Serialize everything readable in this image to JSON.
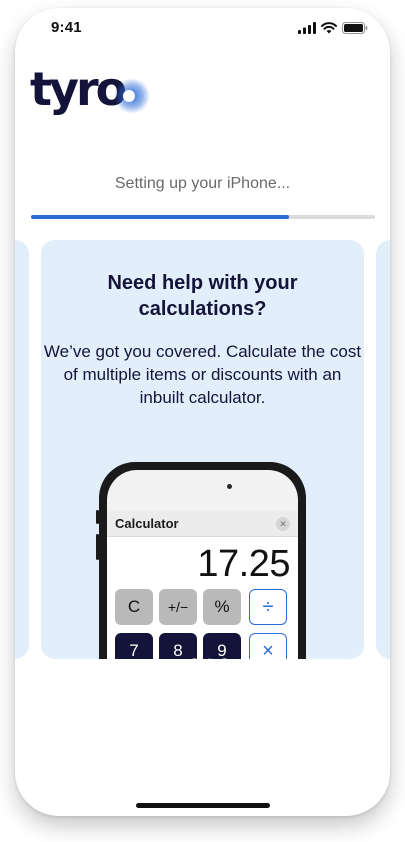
{
  "status_bar": {
    "time": "9:41",
    "icons": [
      "signal-icon",
      "wifi-icon",
      "battery-icon"
    ]
  },
  "brand": {
    "logo_text": "tyro",
    "color": "#14143a",
    "splash_color": "#2a6bd6"
  },
  "setup": {
    "text": "Setting up your iPhone...",
    "progress": 0.75,
    "progress_color": "#2a6bd6"
  },
  "card": {
    "title": "Need help with your calculations?",
    "body": "We’ve got you covered. Calculate the cost of multiple items or discounts with an inbuilt calculator.",
    "background": "#e3eefb"
  },
  "calculator": {
    "title": "Calculator",
    "close_icon": "close-icon",
    "display": "17.25",
    "keys_row1": [
      "C",
      "+/−",
      "%",
      "÷"
    ],
    "keys_row2": [
      "7",
      "8",
      "9",
      "×"
    ]
  },
  "carousel": {
    "page_count": 3,
    "active_index": 1
  }
}
